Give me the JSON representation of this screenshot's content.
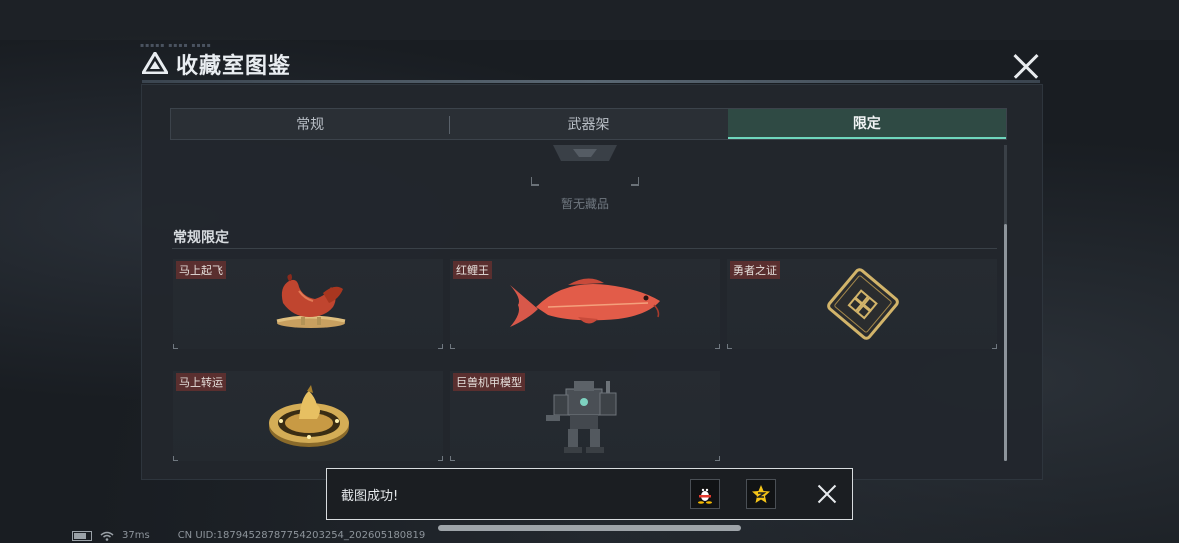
{
  "header": {
    "title": "收藏室图鉴",
    "deco_text": "▪▪▪▪▪ ▪▪▪▪ ▪▪▪▪"
  },
  "tabs": [
    {
      "label": "常规",
      "active": false
    },
    {
      "label": "武器架",
      "active": false
    },
    {
      "label": "限定",
      "active": true
    }
  ],
  "empty_state": {
    "text": "暂无藏品"
  },
  "section": {
    "title": "常规限定",
    "items": [
      {
        "label": "马上起飞",
        "icon": "horse-statue-icon"
      },
      {
        "label": "红鲤王",
        "icon": "red-carp-icon"
      },
      {
        "label": "勇者之证",
        "icon": "golden-card-icon"
      },
      {
        "label": "马上转运",
        "icon": "golden-disc-icon"
      },
      {
        "label": "巨兽机甲模型",
        "icon": "mech-model-icon"
      }
    ]
  },
  "toast": {
    "message": "截图成功!",
    "qq_icon": "qq-penguin-icon",
    "qzone_icon": "qzone-star-icon"
  },
  "status": {
    "ping": "37ms",
    "uid": "CN UID:18794528787754203254_202605180819"
  },
  "colors": {
    "accent": "#6fd6bd",
    "label_bg": "#5a2f2f",
    "panel_bg": "#22272d"
  }
}
